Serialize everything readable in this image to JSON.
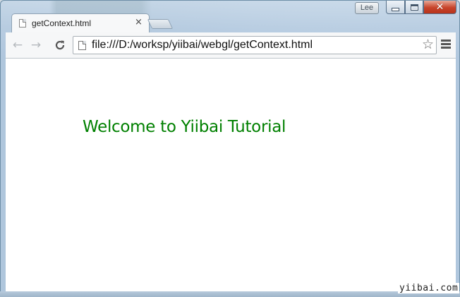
{
  "window": {
    "profile_label": "Lee",
    "controls": {
      "minimize": "minimize",
      "maximize": "maximize",
      "close": "close"
    }
  },
  "tab": {
    "title": "getContext.html",
    "close_glyph": "×"
  },
  "toolbar": {
    "back_glyph": "←",
    "forward_glyph": "→",
    "reload_glyph": "C",
    "url": "file:///D:/worksp/yiibai/webgl/getContext.html",
    "bookmark_glyph": "☆"
  },
  "page": {
    "heading": "Welcome to Yiibai Tutorial",
    "heading_color": "#008000"
  },
  "watermark": "yiibai.com"
}
